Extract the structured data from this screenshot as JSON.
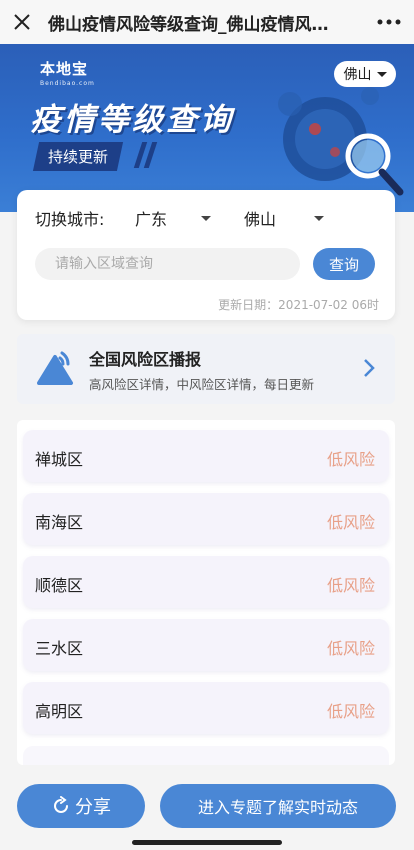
{
  "nav": {
    "title": "佛山疫情风险等级查询_佛山疫情风…"
  },
  "banner": {
    "brand_name": "本地宝",
    "brand_sub": "Bendibao.com",
    "headline": "疫情等级查询",
    "tagline": "持续更新",
    "city_badge": "佛山"
  },
  "query": {
    "switch_label": "切换城市:",
    "province": "广东",
    "city": "佛山",
    "search_placeholder": "请输入区域查询",
    "search_button": "查询",
    "update_date": "更新日期：2021-07-02 06时"
  },
  "notice": {
    "title": "全国风险区播报",
    "subtitle": "高风险区详情，中风险区详情，每日更新"
  },
  "districts": [
    {
      "name": "禅城区",
      "level": "低风险"
    },
    {
      "name": "南海区",
      "level": "低风险"
    },
    {
      "name": "顺德区",
      "level": "低风险"
    },
    {
      "name": "三水区",
      "level": "低风险"
    },
    {
      "name": "高明区",
      "level": "低风险"
    }
  ],
  "footer": {
    "share": "分享",
    "enter": "进入专题了解实时动态"
  },
  "colors": {
    "accent": "#4a87d5",
    "risk_low": "#e8a088",
    "banner": "#2f6ecb"
  }
}
